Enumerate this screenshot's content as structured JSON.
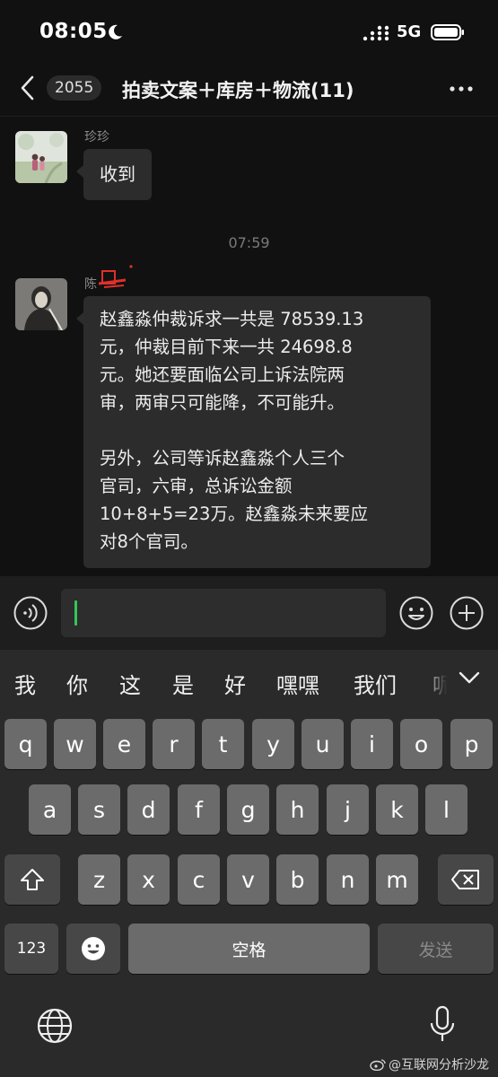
{
  "status_bar": {
    "time": "08:05",
    "network": "5G"
  },
  "nav": {
    "unread_count": "2055",
    "title": "拍卖文案＋库房＋物流(11)"
  },
  "chat": {
    "messages": [
      {
        "sender": "珍珍",
        "text": "收到"
      },
      {
        "sender": "陈",
        "paragraphs": [
          [
            "赵鑫淼仲裁诉求一共是 78539.13",
            "元，仲裁目前下来一共 24698.8",
            "元。她还要面临公司上诉法院两",
            "审，两审只可能降，不可能升。"
          ],
          [
            "另外，公司等诉赵鑫淼个人三个",
            "官司，六审，总诉讼金额",
            "10+8+5=23万。赵鑫淼未来要应",
            "对8个官司。"
          ]
        ]
      }
    ],
    "timestamp": "07:59"
  },
  "keyboard": {
    "candidates": [
      "我",
      "你",
      "这",
      "是",
      "好",
      "嘿嘿",
      "我们",
      "呢"
    ],
    "row1": [
      "q",
      "w",
      "e",
      "r",
      "t",
      "y",
      "u",
      "i",
      "o",
      "p"
    ],
    "row2": [
      "a",
      "s",
      "d",
      "f",
      "g",
      "h",
      "j",
      "k",
      "l"
    ],
    "row3": [
      "z",
      "x",
      "c",
      "v",
      "b",
      "n",
      "m"
    ],
    "numbers_label": "123",
    "space_label": "空格",
    "send_label": "发送"
  },
  "watermark": "@互联网分析沙龙",
  "colors": {
    "cursor": "#34c759",
    "background": "#111111",
    "bubble": "#2c2c2c"
  },
  "icons": [
    "moon-icon",
    "signal-icon",
    "battery-icon",
    "back-chevron-icon",
    "more-icon",
    "voice-icon",
    "emoji-icon",
    "add-icon",
    "chevron-down-icon",
    "shift-icon",
    "backspace-icon",
    "emoji-key-icon",
    "globe-icon",
    "mic-icon",
    "weibo-icon"
  ]
}
